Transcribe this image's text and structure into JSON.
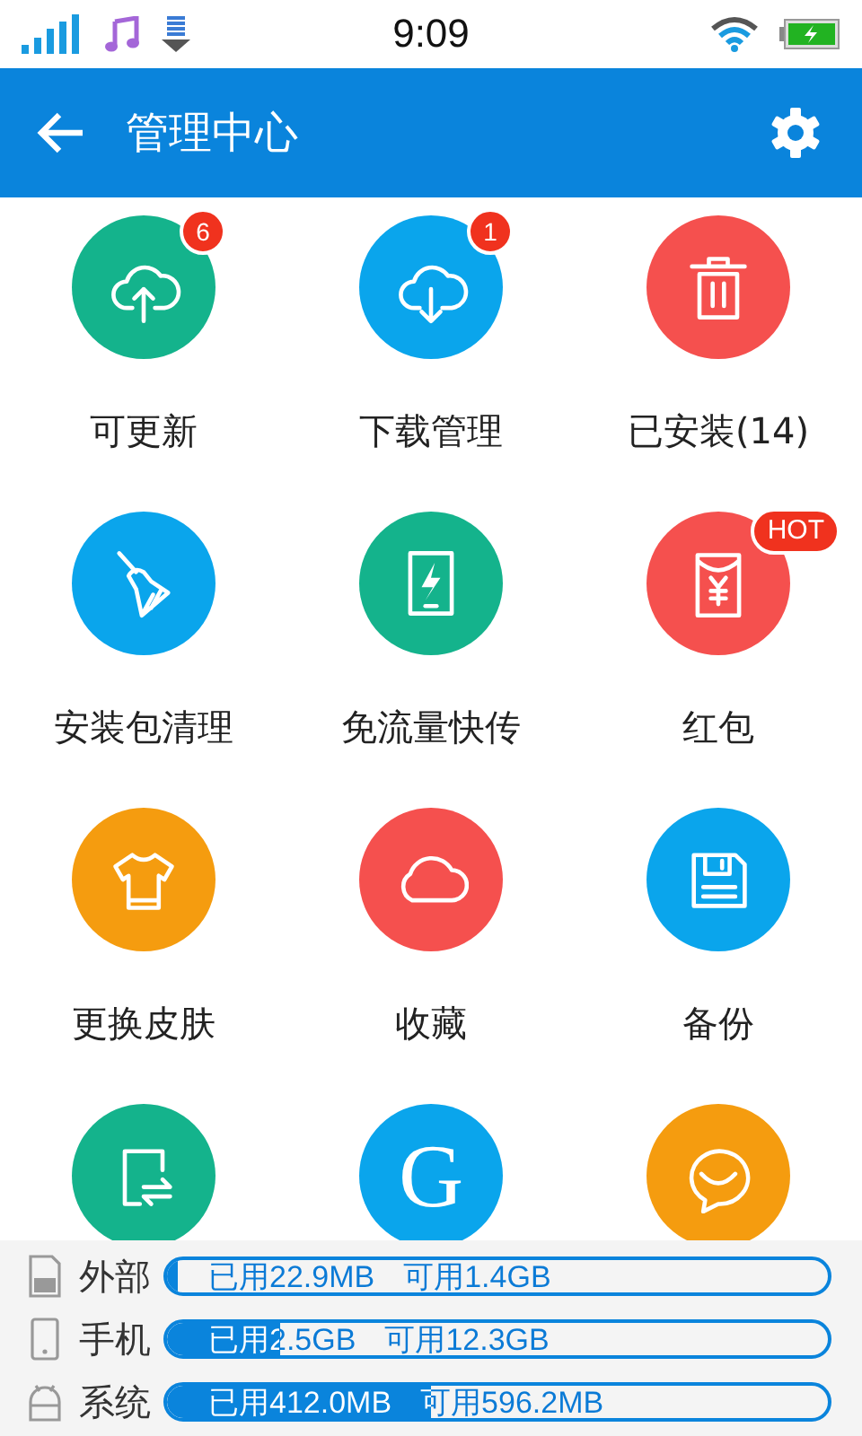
{
  "status_bar": {
    "time": "9:09"
  },
  "app_bar": {
    "title": "管理中心"
  },
  "grid": [
    {
      "label": "可更新",
      "color": "#14b38c",
      "badge": "6"
    },
    {
      "label": "下载管理",
      "color": "#0aa5ec",
      "badge": "1"
    },
    {
      "label": "已安装(14)",
      "color": "#f5504e"
    },
    {
      "label": "安装包清理",
      "color": "#0aa5ec"
    },
    {
      "label": "免流量快传",
      "color": "#14b38c"
    },
    {
      "label": "红包",
      "color": "#f5504e",
      "badge": "HOT"
    },
    {
      "label": "更换皮肤",
      "color": "#f59c0f"
    },
    {
      "label": "收藏",
      "color": "#f5504e"
    },
    {
      "label": "备份",
      "color": "#0aa5ec"
    },
    {
      "color": "#14b38c"
    },
    {
      "color": "#0aa5ec",
      "glyph": "G"
    },
    {
      "color": "#f59c0f"
    }
  ],
  "storage": [
    {
      "label": "外部",
      "used": "已用22.9MB",
      "free": "可用1.4GB",
      "level": 0.015
    },
    {
      "label": "手机",
      "used": "已用2.5GB",
      "free": "可用12.3GB",
      "level": 0.17
    },
    {
      "label": "系统",
      "used": "已用412.0MB",
      "free": "可用596.2MB",
      "level": 0.4
    }
  ]
}
